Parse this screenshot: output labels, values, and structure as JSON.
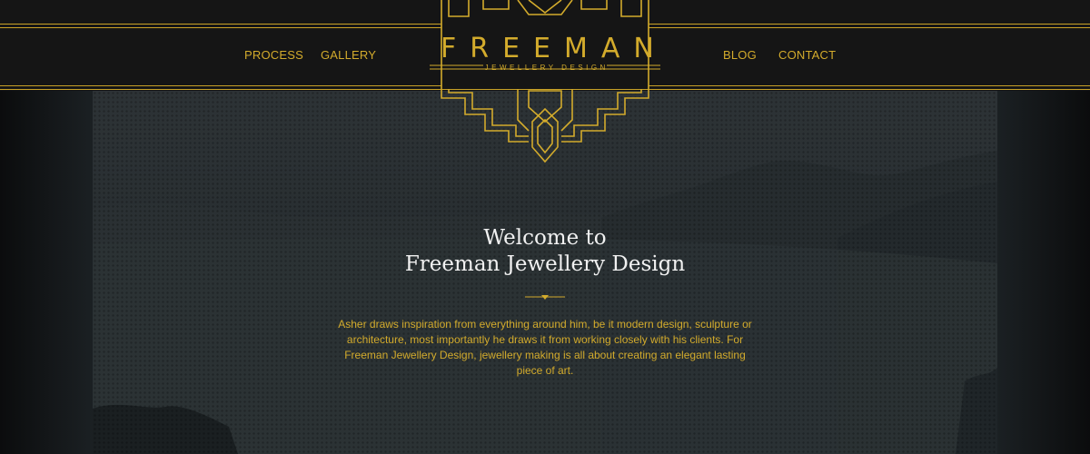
{
  "nav": {
    "left": [
      "PROCESS",
      "GALLERY"
    ],
    "right": [
      "BLOG",
      "CONTACT"
    ]
  },
  "logo": {
    "name": "FREEMAN",
    "tagline": "JEWELLERY DESIGN"
  },
  "hero": {
    "title_line1": "Welcome to",
    "title_line2": "Freeman Jewellery Design",
    "description": "Asher draws inspiration from everything around him, be it modern design, sculpture or architecture, most importantly he draws it from working closely with his clients. For Freeman Jewellery Design, jewellery making is all about creating an elegant lasting piece of art."
  },
  "colors": {
    "gold": "#d3ab2c",
    "navbar_bg": "#151515",
    "heading": "#f1f1f1"
  }
}
